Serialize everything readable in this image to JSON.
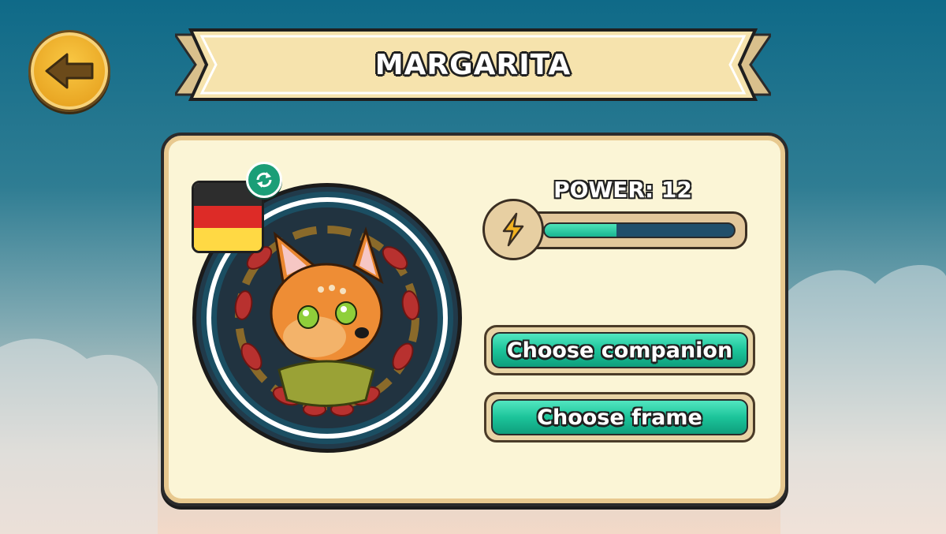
{
  "header": {
    "back_icon": "arrow-left-icon",
    "title": "MARGARITA"
  },
  "profile": {
    "flag": {
      "country": "Germany",
      "colors": [
        "#2d2d2d",
        "#dd2b27",
        "#ffd944"
      ]
    },
    "swap_icon": "refresh-icon",
    "avatar": "fox-companion"
  },
  "power": {
    "label": "POWER: 12",
    "icon": "lightning-icon",
    "fill_fraction": 0.38
  },
  "actions": {
    "choose_companion": "Choose companion",
    "choose_frame": "Choose frame"
  },
  "colors": {
    "accent_green": "#1cc49a",
    "panel_bg": "#fbf5d6",
    "gold": "#e9a623"
  }
}
